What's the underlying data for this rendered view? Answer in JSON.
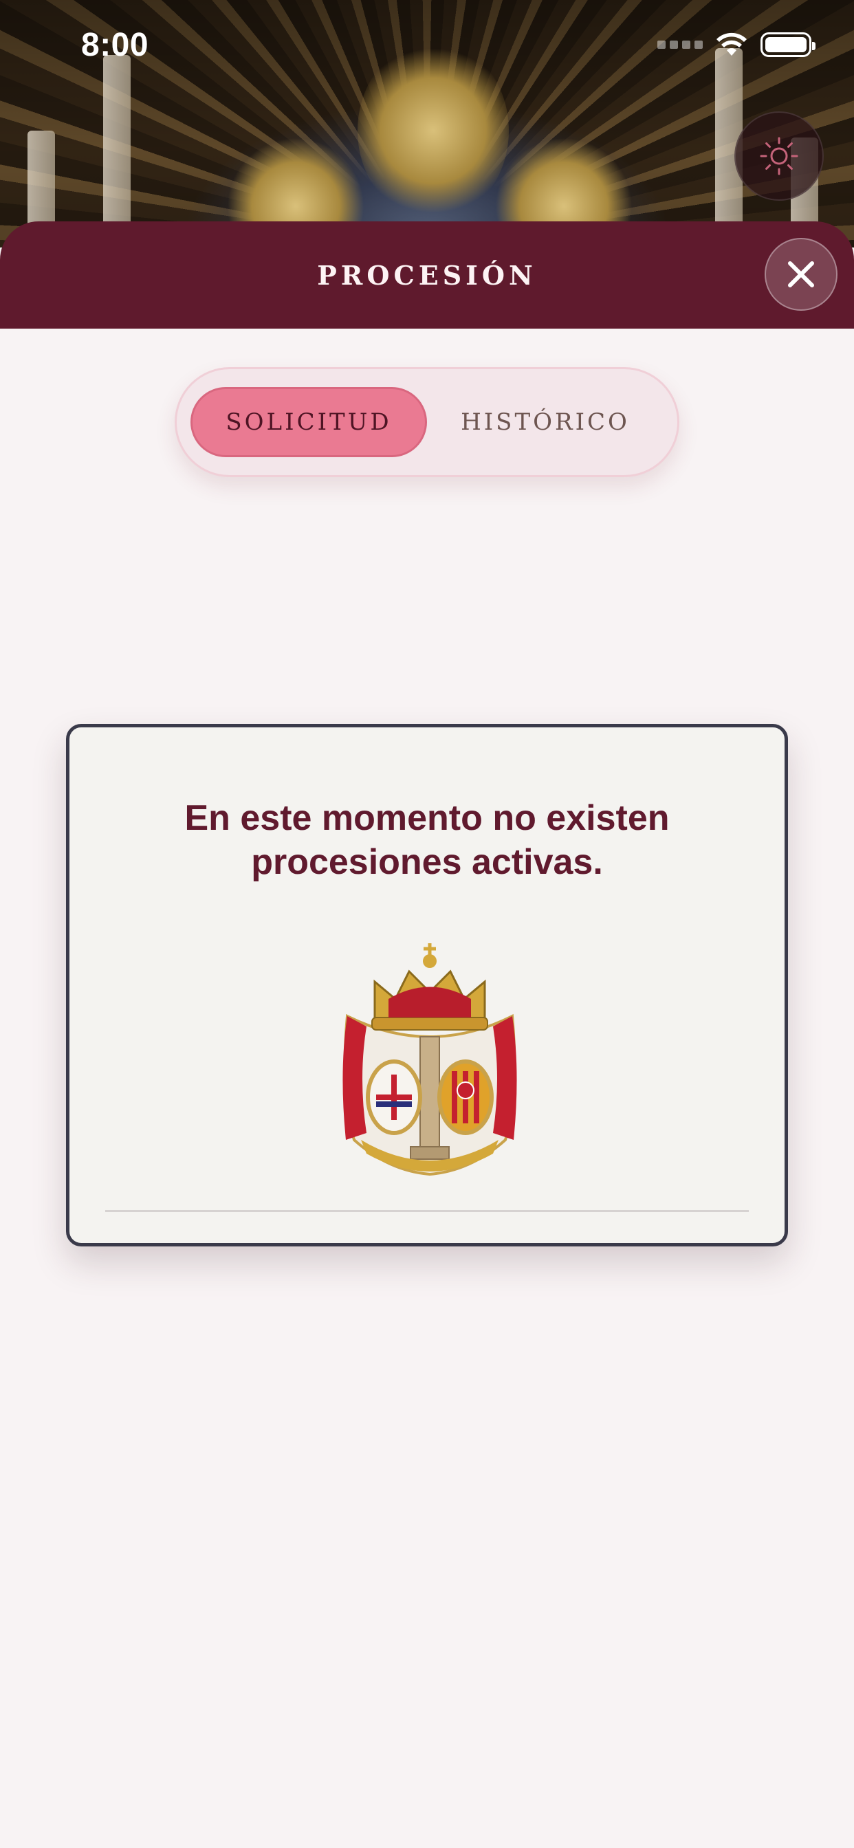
{
  "status_bar": {
    "time": "8:00"
  },
  "header": {
    "title": "PROCESIÓN"
  },
  "tabs": [
    {
      "label": "SOLICITUD",
      "active": true
    },
    {
      "label": "HISTÓRICO",
      "active": false
    }
  ],
  "empty_state": {
    "message": "En este momento no existen procesiones activas."
  },
  "icons": {
    "theme_toggle": "sun-icon",
    "close": "close-icon",
    "emblem": "coat-of-arms-emblem"
  },
  "colors": {
    "brand": "#5f1a2d",
    "accent": "#ea7a92",
    "background": "#f8f3f4",
    "card": "#f4f3f0"
  }
}
